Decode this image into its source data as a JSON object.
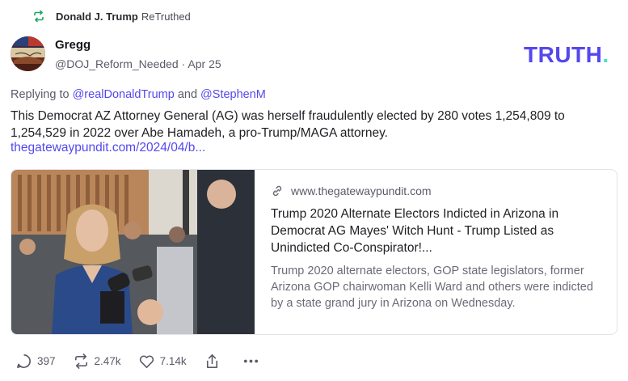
{
  "retruth": {
    "name": "Donald J. Trump",
    "suffix": "ReTruthed"
  },
  "author": {
    "display_name": "Gregg",
    "handle_date": "@DOJ_Reform_Needed · Apr 25"
  },
  "brand": {
    "logo_text": "TRUTH",
    "logo_dot": "."
  },
  "reply": {
    "prefix": "Replying to",
    "mention_1": "@realDonaldTrump",
    "joiner": "and",
    "mention_2": "@StephenM"
  },
  "post": {
    "body": "This Democrat AZ Attorney General (AG) was herself fraudulently elected by 280 votes 1,254,809 to 1,254,529 in 2022 over Abe Hamadeh, a pro-Trump/MAGA attorney.",
    "link": "thegatewaypundit.com/2024/04/b..."
  },
  "card": {
    "domain": "www.thegatewaypundit.com",
    "title": "Trump 2020 Alternate Electors Indicted in Arizona in Democrat AG Mayes' Witch Hunt - Trump Listed as Unindicted Co-Conspirator!...",
    "description": "Trump 2020 alternate electors, GOP state legislators, former Arizona GOP chairwoman Kelli Ward and others were indicted by a state grand jury in Arizona on Wednesday."
  },
  "actions": {
    "replies": "397",
    "retruths": "2.47k",
    "likes": "7.14k"
  },
  "colors": {
    "accent": "#5448ee",
    "retruth_green": "#1fa36b",
    "brand_dot": "#4ee0c8"
  },
  "icons": [
    "retruth-icon",
    "link-icon",
    "reply-icon",
    "retruth-action-icon",
    "like-icon",
    "share-icon",
    "more-icon"
  ]
}
